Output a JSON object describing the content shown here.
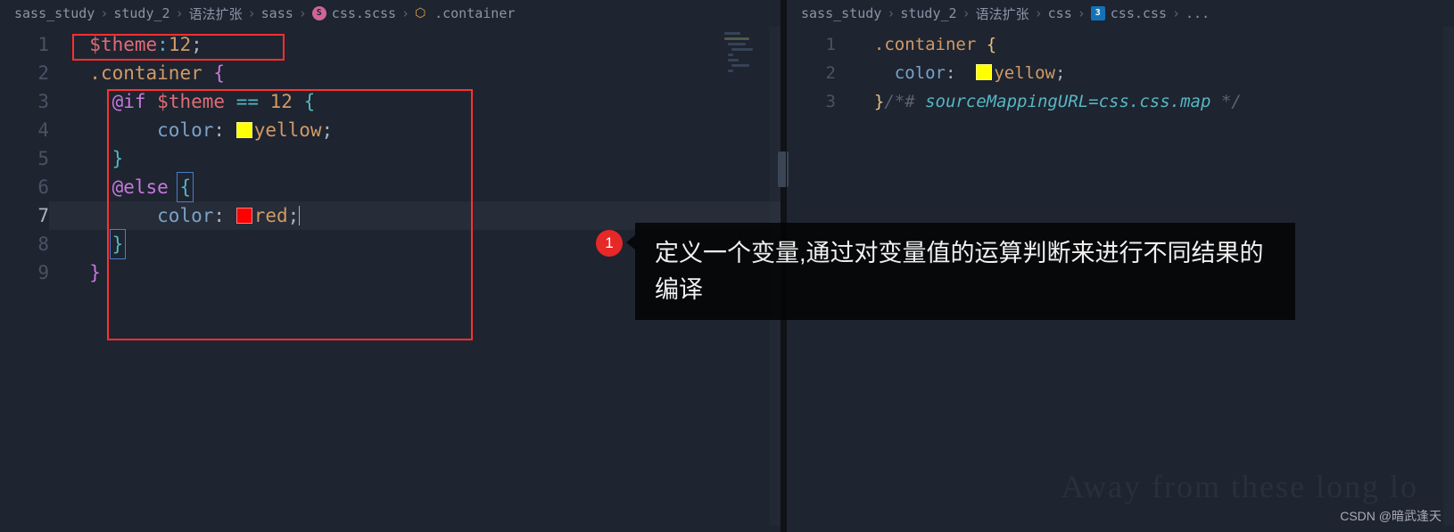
{
  "leftPane": {
    "breadcrumb": [
      "sass_study",
      "study_2",
      "语法扩张",
      "sass",
      "css.scss",
      ".container"
    ],
    "fileIcon": "sass-icon",
    "structIcon": "struct-icon",
    "lines": {
      "1": {
        "var": "$theme",
        "colon": ":",
        "val": "12",
        "semi": ";"
      },
      "2": {
        "sel": ".container",
        "brace": "{"
      },
      "3": {
        "kw": "@if",
        "var": "$theme",
        "op": "==",
        "num": "12",
        "brace": "{"
      },
      "4": {
        "prop": "color",
        "colon": ":",
        "swatch": "yellow",
        "val": "yellow",
        "semi": ";"
      },
      "5": {
        "brace": "}"
      },
      "6": {
        "kw": "@else",
        "brace": "{"
      },
      "7": {
        "prop": "color",
        "colon": ":",
        "swatch": "red",
        "val": "red",
        "semi": ";"
      },
      "8": {
        "brace": "}"
      },
      "9": {
        "brace": "}"
      }
    },
    "lineNumbers": [
      "1",
      "2",
      "3",
      "4",
      "5",
      "6",
      "7",
      "8",
      "9"
    ]
  },
  "rightPane": {
    "breadcrumb": [
      "sass_study",
      "study_2",
      "语法扩张",
      "css",
      "css.css",
      "..."
    ],
    "fileIcon": "css-icon",
    "lines": {
      "1": {
        "sel": ".container",
        "brace": "{"
      },
      "2": {
        "prop": "color",
        "colon": ":",
        "swatch": "yellow",
        "val": "yellow",
        "semi": ";"
      },
      "3": {
        "brace": "}",
        "comment": "/*# ",
        "url": "sourceMappingURL=css.css.map",
        "commentEnd": " */"
      }
    },
    "lineNumbers": [
      "1",
      "2",
      "3"
    ]
  },
  "annotation": {
    "number": "1",
    "text": "定义一个变量,通过对变量值的运算判断来进行不同结果的编译"
  },
  "watermark": "CSDN @暗武逢天",
  "bgText": "Away from these long lo",
  "colors": {
    "yellow": "#ffff00",
    "red": "#ff0000"
  }
}
